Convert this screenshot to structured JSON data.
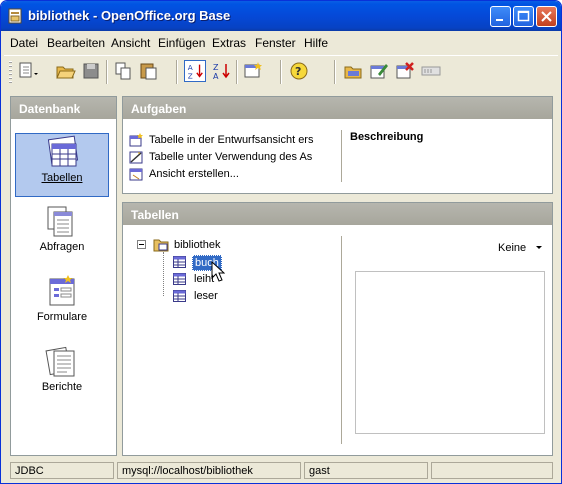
{
  "window": {
    "title": "bibliothek - OpenOffice.org Base"
  },
  "menu": [
    "Datei",
    "Bearbeiten",
    "Ansicht",
    "Einfügen",
    "Extras",
    "Fenster",
    "Hilfe"
  ],
  "datenbank": {
    "header": "Datenbank",
    "items": [
      {
        "label": "Tabellen",
        "icon": "tables-icon",
        "selected": true
      },
      {
        "label": "Abfragen",
        "icon": "queries-icon"
      },
      {
        "label": "Formulare",
        "icon": "forms-icon"
      },
      {
        "label": "Berichte",
        "icon": "reports-icon"
      }
    ]
  },
  "aufgaben": {
    "header": "Aufgaben",
    "tasks": [
      "Tabelle in der Entwurfsansicht ers",
      "Tabelle unter Verwendung des As",
      "Ansicht erstellen..."
    ],
    "description_label": "Beschreibung"
  },
  "tabellen": {
    "header": "Tabellen",
    "root": "bibliothek",
    "items": [
      "buch",
      "leiht",
      "leser"
    ],
    "selected": "buch",
    "preview_mode": "Keine"
  },
  "statusbar": [
    "JDBC",
    "mysql://localhost/bibliothek",
    "gast",
    ""
  ]
}
